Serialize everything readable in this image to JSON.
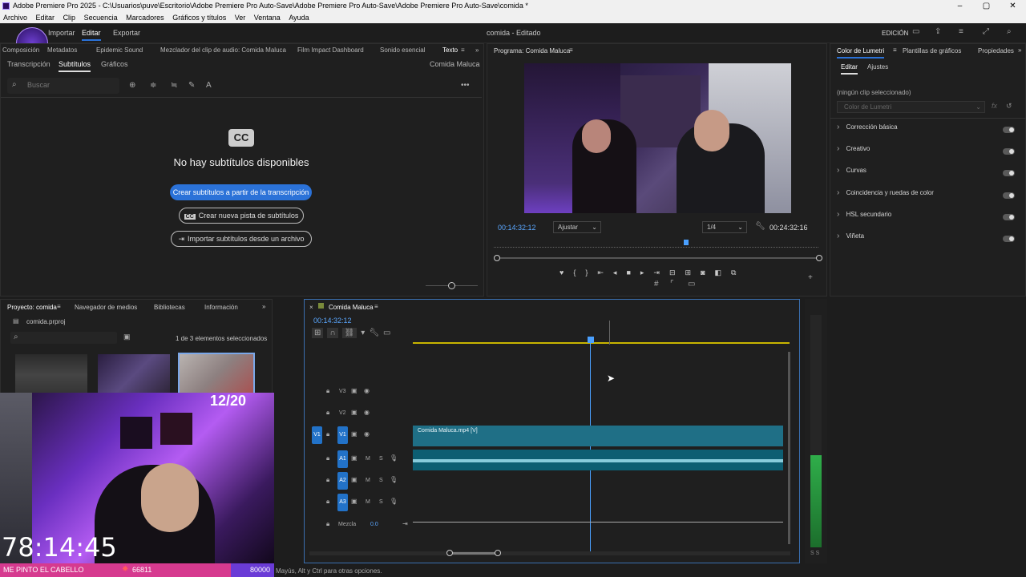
{
  "window": {
    "title": "Adobe Premiere Pro 2025 - C:\\Usuarios\\puve\\Escritorio\\Adobe Premiere Pro Auto-Save\\Adobe Premiere Pro Auto-Save\\Adobe Premiere Pro Auto-Save\\comida *"
  },
  "menu": [
    "Archivo",
    "Editar",
    "Clip",
    "Secuencia",
    "Marcadores",
    "Gráficos y títulos",
    "Ver",
    "Ventana",
    "Ayuda"
  ],
  "workspace": {
    "tabs": [
      "Importar",
      "Editar",
      "Exportar"
    ],
    "active": "Editar",
    "doc_title": "comida - Editado",
    "mode": "EDICIÓN"
  },
  "left_panel": {
    "tabs": [
      "Composición",
      "Metadatos",
      "Epidemic Sound",
      "Mezclador del clip de audio: Comida Maluca",
      "Film Impact Dashboard",
      "Sonido esencial",
      "Texto"
    ],
    "subtabs": [
      "Transcripción",
      "Subtítulos",
      "Gráficos"
    ],
    "sequence": "Comida Maluca",
    "search_placeholder": "Buscar",
    "cc_label": "CC",
    "empty_title": "No hay subtítulos disponibles",
    "btn_create_from_transcript": "Crear subtítulos a partir de la transcripción",
    "btn_new_track": "Crear nueva pista de subtítulos",
    "btn_import": "Importar subtítulos desde un archivo"
  },
  "program": {
    "title": "Programa: Comida Maluca",
    "timecode": "00:14:32:12",
    "fit": "Ajustar",
    "resolution": "1/4",
    "duration": "00:24:32:16"
  },
  "lumetri": {
    "tabs": [
      "Color de Lumetri",
      "Plantillas de gráficos",
      "Propiedades"
    ],
    "subtabs": [
      "Editar",
      "Ajustes"
    ],
    "no_clip": "(ningún clip seleccionado)",
    "dropdown": "Color de Lumetri",
    "sections": [
      "Corrección básica",
      "Creativo",
      "Curvas",
      "Coincidencia y ruedas de color",
      "HSL secundario",
      "Viñeta"
    ]
  },
  "project": {
    "tabs": [
      "Proyecto: comida",
      "Navegador de medios",
      "Bibliotecas",
      "Información"
    ],
    "file": "comida.prproj",
    "selection": "1 de 3 elementos seleccionados"
  },
  "timeline": {
    "sequence": "Comida Maluca",
    "timecode": "00:14:32:12",
    "tracks": [
      {
        "id": "V3",
        "kind": "video"
      },
      {
        "id": "V2",
        "kind": "video"
      },
      {
        "id": "V1",
        "kind": "video",
        "src": "V1"
      },
      {
        "id": "A1",
        "kind": "audio"
      },
      {
        "id": "A2",
        "kind": "audio"
      },
      {
        "id": "A3",
        "kind": "audio"
      }
    ],
    "video_clip": "Comida Maluca.mp4 [V]",
    "mix_label": "Mezcla",
    "mix_value": "0.0"
  },
  "meter": {
    "labels": "S S"
  },
  "stream": {
    "counter": "12/20",
    "timer": "78:14:45",
    "banner": "ME PINTO EL CABELLO",
    "count1": "66811",
    "count2": "80000"
  },
  "status": "Mayús, Alt y Ctrl para otras opciones."
}
